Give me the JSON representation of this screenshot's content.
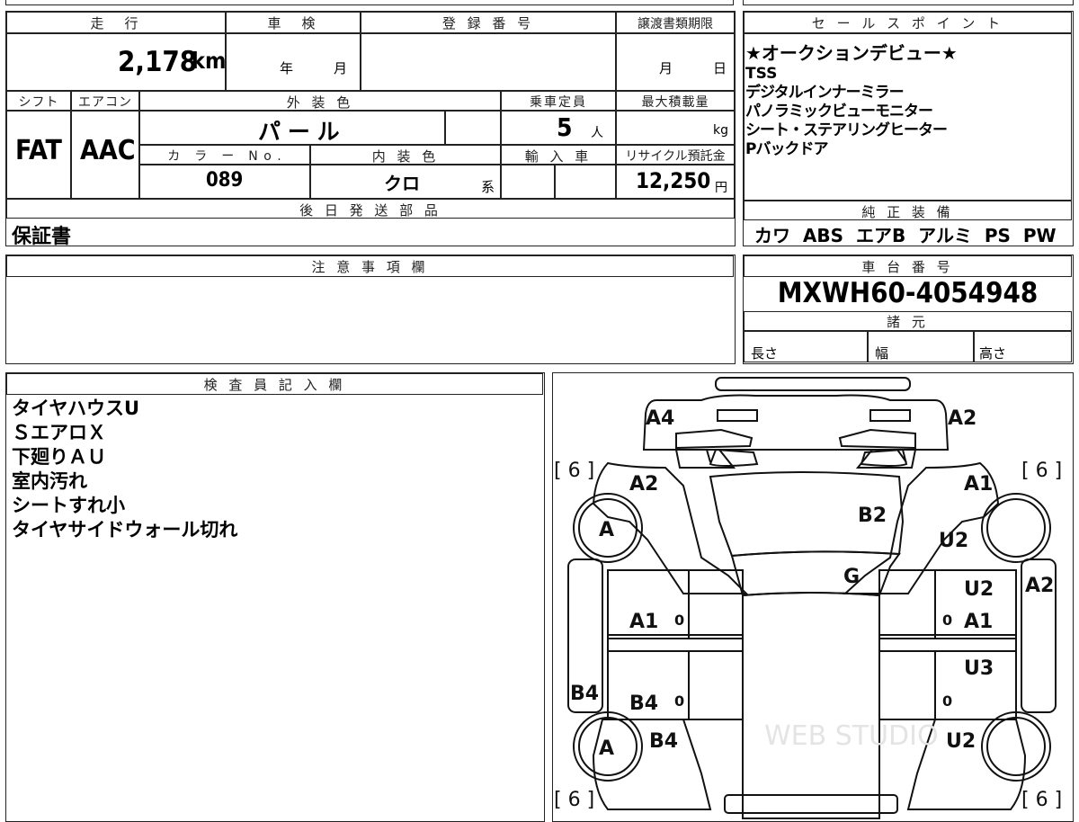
{
  "vehicle": {
    "mileage_label": "走　行",
    "mileage": "2,178",
    "mileage_unit": "km",
    "inspection_label": "車　検",
    "inspection_year": "年",
    "inspection_month": "月",
    "registration_label": "登 録 番 号",
    "transfer_label": "譲渡書類期限",
    "transfer_month": "月",
    "transfer_day": "日",
    "shift_label": "シフト",
    "shift": "FAT",
    "aircon_label": "エアコン",
    "aircon": "AAC",
    "exterior_color_label": "外 装 色",
    "exterior_color": "パ ー ル",
    "capacity_label": "乗車定員",
    "capacity": "5",
    "capacity_unit": "人",
    "max_load_label": "最大積載量",
    "max_load_unit": "kg",
    "color_no_label": "カ　ラ　ー　N o .",
    "color_no": "089",
    "interior_color_label": "内 装 色",
    "interior_color": "クロ",
    "interior_suffix": "系",
    "import_label": "輸 入 車",
    "recycle_label": "リサイクル預託金",
    "recycle_fee": "12,250",
    "recycle_unit": "円",
    "later_parts_label": "後 日 発 送 部 品",
    "later_parts": "保証書"
  },
  "sales_points": {
    "label": "セ ー ル ス ポ イ ン ト",
    "lines": [
      "★オークションデビュー★",
      "TSS",
      "デジタルインナーミラー",
      "パノラミックビューモニター",
      "シート・ステアリングヒーター",
      "Pバックドア"
    ]
  },
  "equipment": {
    "label": "純 正 装 備",
    "items": "カワ  ABS  エアB  アルミ  PS  PW"
  },
  "caution": {
    "label": "注 意 事 項 欄"
  },
  "chassis": {
    "label": "車 台 番 号",
    "number": "MXWH60-4054948",
    "specs_label": "諸 元",
    "length_label": "長さ",
    "width_label": "幅",
    "height_label": "高さ"
  },
  "inspector": {
    "label": "検 査 員 記 入 欄",
    "lines": [
      "タイヤハウスU",
      "ＳエアロＸ",
      "下廻りＡＵ",
      "室内汚れ",
      "シートすれ小",
      "タイヤサイドウォール切れ"
    ]
  },
  "diagram": {
    "marks": {
      "a4_top": "A4",
      "a2_top": "A2",
      "a2_front_left": "A2",
      "a1_front_right": "A1",
      "b2_windshield": "B2",
      "u2_front_right": "U2",
      "g_glass": "G",
      "u2_side_right": "U2",
      "a2_side_right": "A2",
      "a1_door_left": "A1",
      "a1_door_right": "A1",
      "u3_door_right": "U3",
      "b4_side_left": "B4",
      "b4_door_left": "B4",
      "b4_rear_left": "B4",
      "u2_rear_right": "U2"
    },
    "tyre_front_left": "A",
    "tyre_rear_left": "A",
    "tread_fl": "[ 6 ]",
    "tread_fr": "[ 6 ]",
    "tread_rl": "[ 6 ]",
    "tread_rr": "[ 6 ]",
    "zero_mark": "0"
  },
  "watermark": "WEB STUDIO"
}
